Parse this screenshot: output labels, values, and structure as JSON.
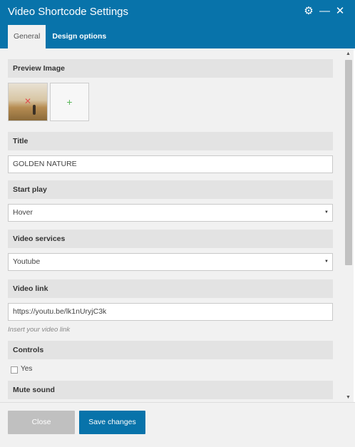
{
  "window": {
    "title": "Video Shortcode Settings",
    "icons": [
      "gear-icon",
      "minimize-icon",
      "close-icon"
    ]
  },
  "tabs": [
    {
      "label": "General",
      "active": true
    },
    {
      "label": "Design options",
      "active": false
    }
  ],
  "sections": {
    "preview_image": "Preview Image",
    "title": "Title",
    "start_play": "Start play",
    "video_services": "Video services",
    "video_link": "Video link",
    "controls": "Controls",
    "mute_sound": "Mute sound"
  },
  "fields": {
    "title_value": "GOLDEN NATURE",
    "start_play_value": "Hover",
    "video_services_value": "Youtube",
    "video_link_value": "https://youtu.be/lk1nUryjC3k",
    "video_link_hint": "Insert your video link",
    "controls_label": "Yes",
    "controls_checked": false
  },
  "footer": {
    "close_label": "Close",
    "save_label": "Save changes"
  },
  "colors": {
    "accent": "#0873aa",
    "add_icon": "#5cb85c",
    "remove_icon": "#e05050"
  }
}
